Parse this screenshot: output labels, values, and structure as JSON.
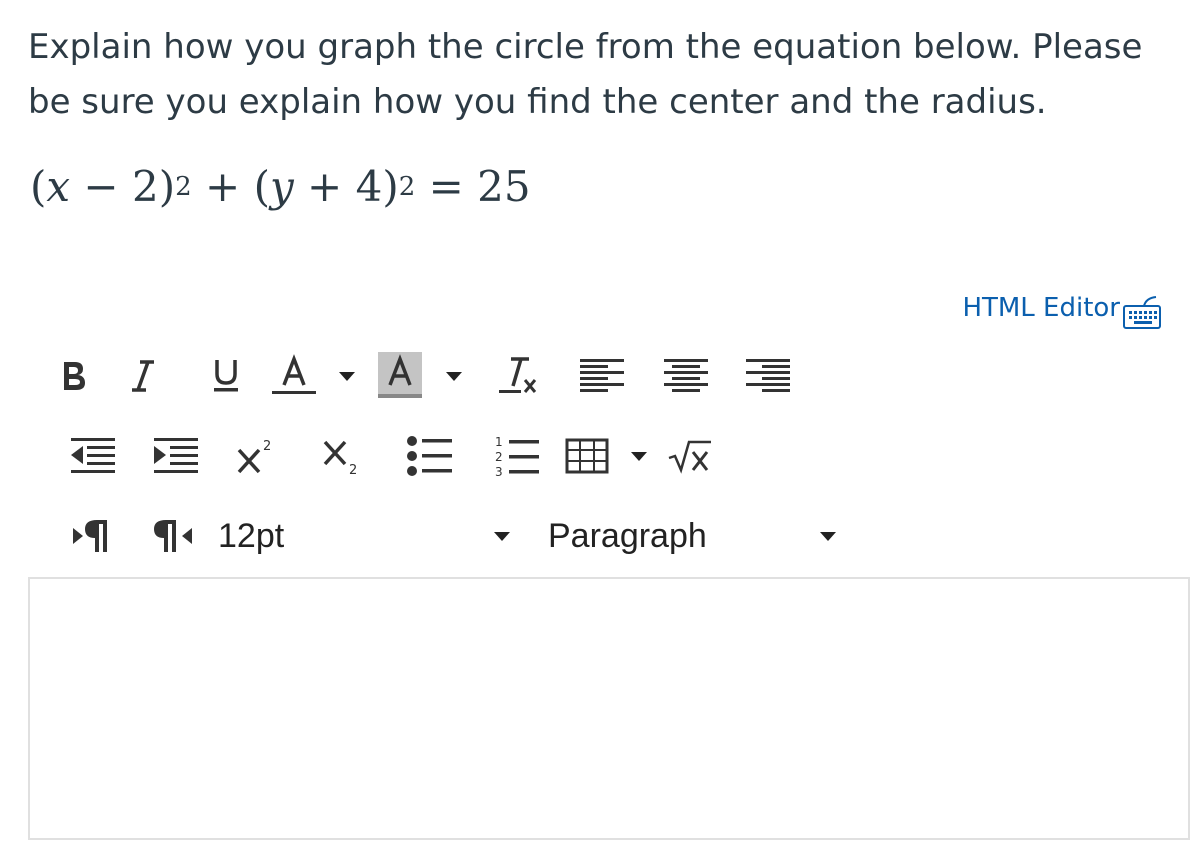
{
  "question": {
    "text": "Explain how you graph the circle from the equation below.  Please be sure you explain how you find the center and the radius."
  },
  "equation": {
    "open1": "(",
    "var1": "x",
    "minus": " − ",
    "num1": "2",
    "close1": ")",
    "exp1": "2",
    "plus1": " + ",
    "open2": "(",
    "var2": "y",
    "plus2": " + ",
    "num2": "4",
    "close2": ")",
    "exp2": "2",
    "equals": " = ",
    "rhs": "25"
  },
  "html_editor_link": {
    "label": "HTML Editor",
    "icon": "keyboard-icon"
  },
  "toolbar": {
    "font_size": {
      "value": "12pt"
    },
    "format": {
      "value": "Paragraph"
    }
  },
  "colors": {
    "link": "#0b5fae",
    "text": "#2d3b45",
    "border": "#e0e0e0"
  }
}
